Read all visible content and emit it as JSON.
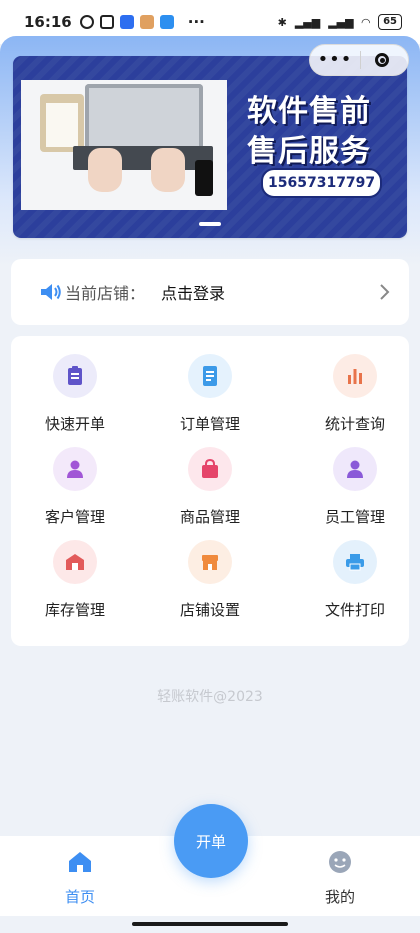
{
  "status_bar": {
    "time": "16:16",
    "more": "···",
    "battery": "65"
  },
  "banner": {
    "title_line1": "软件售前",
    "title_line2": "售后服务",
    "phone": "15657317797"
  },
  "store": {
    "label": "当前店铺：",
    "value": "点击登录"
  },
  "menu": [
    {
      "label": "快速开单",
      "icon": "clipboard-icon",
      "color": "#5f54c9",
      "bg": "#ecebfa"
    },
    {
      "label": "订单管理",
      "icon": "document-icon",
      "color": "#3c9ae8",
      "bg": "#e5f2fd"
    },
    {
      "label": "统计查询",
      "icon": "bar-stats-icon",
      "color": "#e8734a",
      "bg": "#fdece5"
    },
    {
      "label": "客户管理",
      "icon": "customer-icon",
      "color": "#a156d6",
      "bg": "#f3e9fa"
    },
    {
      "label": "商品管理",
      "icon": "shopping-bag-icon",
      "color": "#e5456a",
      "bg": "#fde7ec"
    },
    {
      "label": "员工管理",
      "icon": "employee-icon",
      "color": "#8a5ad8",
      "bg": "#efe8fb"
    },
    {
      "label": "库存管理",
      "icon": "warehouse-icon",
      "color": "#e25a5a",
      "bg": "#fde8e8"
    },
    {
      "label": "店铺设置",
      "icon": "storefront-icon",
      "color": "#f08a3c",
      "bg": "#fdeee3"
    },
    {
      "label": "文件打印",
      "icon": "printer-icon",
      "color": "#3a9be8",
      "bg": "#e4f1fc"
    }
  ],
  "footer": "轻账软件@2023",
  "tabbar": {
    "home": "首页",
    "fab": "开单",
    "mine": "我的"
  },
  "colors": {
    "accent": "#3d8ef2",
    "fab": "#4a9bf4",
    "banner": "#2c3f9c"
  }
}
